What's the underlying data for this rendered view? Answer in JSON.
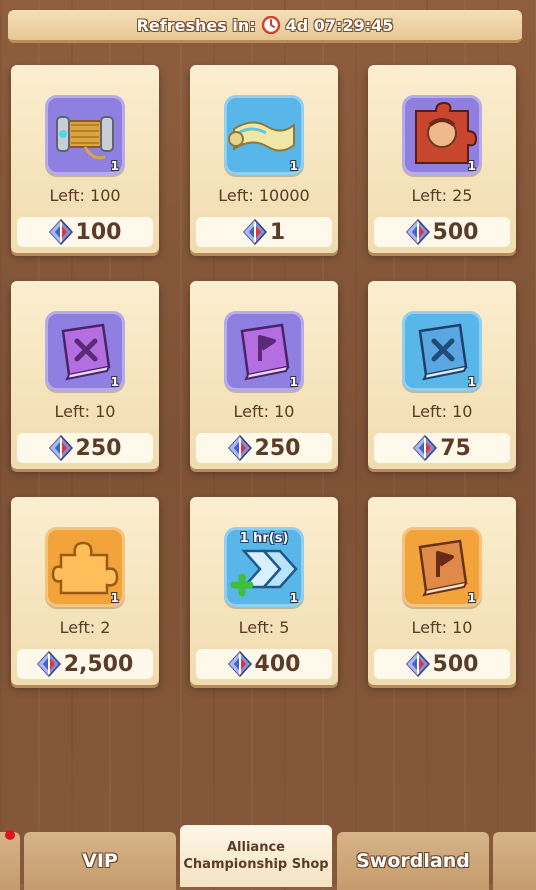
{
  "header": {
    "refresh_label": "Refreshes in:",
    "countdown": "4d 07:29:45",
    "clock_icon": "clock-icon"
  },
  "items": [
    {
      "name_icon": "thread-spool-icon",
      "qty": "1",
      "left": "Left: 100",
      "price": "100",
      "bg": "#8f7fe0"
    },
    {
      "name_icon": "map-scroll-icon",
      "qty": "1",
      "left": "Left: 10000",
      "price": "1",
      "bg": "#58b6e8"
    },
    {
      "name_icon": "hero-portrait-puzzle-icon",
      "qty": "1",
      "left": "Left: 25",
      "price": "500",
      "bg": "#8f7fe0"
    },
    {
      "name_icon": "purple-sword-book-icon",
      "qty": "1",
      "left": "Left: 10",
      "price": "250",
      "bg": "#8f7fe0"
    },
    {
      "name_icon": "purple-flag-book-icon",
      "qty": "1",
      "left": "Left: 10",
      "price": "250",
      "bg": "#8f7fe0"
    },
    {
      "name_icon": "blue-sword-book-icon",
      "qty": "1",
      "left": "Left: 10",
      "price": "75",
      "bg": "#58b6e8"
    },
    {
      "name_icon": "orange-puzzle-piece-icon",
      "qty": "1",
      "left": "Left: 2",
      "price": "2,500",
      "bg": "#f2a33a"
    },
    {
      "name_icon": "speedup-arrows-icon",
      "qty": "1",
      "duration": "1 hr(s)",
      "left": "Left: 5",
      "price": "400",
      "bg": "#58b6e8"
    },
    {
      "name_icon": "orange-flag-book-icon",
      "qty": "1",
      "left": "Left: 10",
      "price": "500",
      "bg": "#f2a33a"
    }
  ],
  "currency_icon": "championship-gem-icon",
  "tabs": [
    {
      "label": ""
    },
    {
      "label": "VIP"
    },
    {
      "label": "Alliance Championship Shop"
    },
    {
      "label": "Swordland"
    },
    {
      "label": ""
    }
  ],
  "colors": {
    "wood": "#86583a",
    "card": "#f6e6c0",
    "price_text": "#5a3c28",
    "notification": "#e0141c"
  }
}
